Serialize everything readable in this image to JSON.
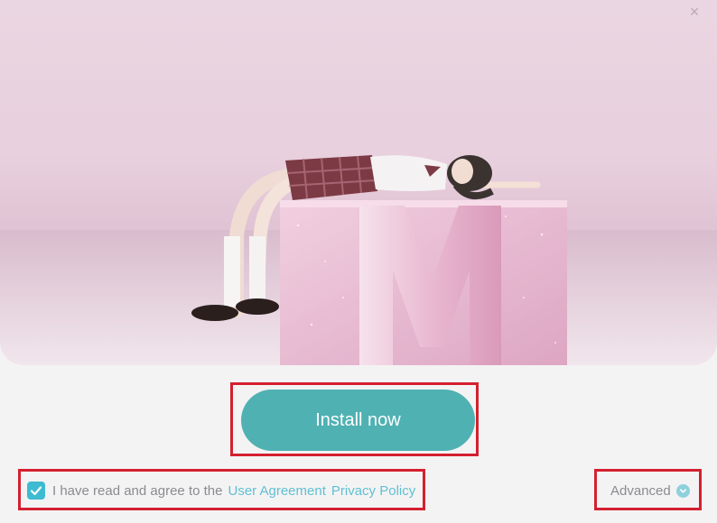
{
  "window": {
    "close_icon": "×"
  },
  "hero": {
    "art_letter": "M"
  },
  "install": {
    "label": "Install now"
  },
  "agreement": {
    "checked": true,
    "text": "I have read and agree to the",
    "user_agreement": "User Agreement",
    "privacy_policy": "Privacy Policy"
  },
  "advanced": {
    "label": "Advanced",
    "icon": "chevron-down-icon"
  },
  "colors": {
    "accent": "#4fb1b2",
    "checkbox": "#3ebbd1",
    "link": "#5fc0d2",
    "highlight_box": "#d4202f"
  }
}
